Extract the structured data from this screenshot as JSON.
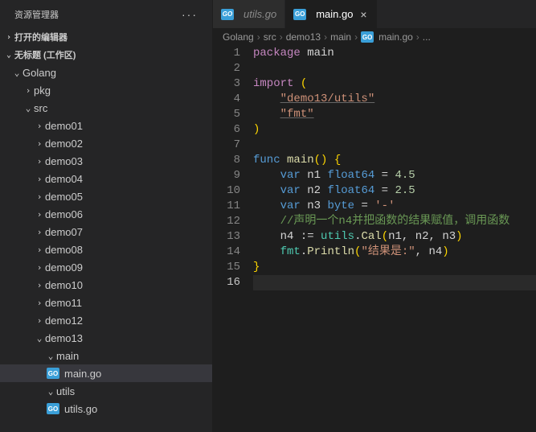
{
  "sidebar": {
    "title": "资源管理器",
    "sections": {
      "openEditors": "打开的编辑器",
      "workspace": "无标题 (工作区)"
    },
    "tree": {
      "golang": "Golang",
      "pkg": "pkg",
      "src": "src",
      "demos": [
        "demo01",
        "demo02",
        "demo03",
        "demo04",
        "demo05",
        "demo06",
        "demo07",
        "demo08",
        "demo09",
        "demo10",
        "demo11",
        "demo12",
        "demo13"
      ],
      "main": "main",
      "mainGo": "main.go",
      "utils": "utils",
      "utilsGo": "utils.go"
    }
  },
  "tabs": {
    "utils": "utils.go",
    "main": "main.go"
  },
  "breadcrumb": {
    "p0": "Golang",
    "p1": "src",
    "p2": "demo13",
    "p3": "main",
    "p4": "main.go",
    "p5": "..."
  },
  "goIconLabel": "GO",
  "code": {
    "lines": [
      {
        "n": 1,
        "html": "<span class='tok-kw'>package</span> <span class='tok-ident'>main</span>"
      },
      {
        "n": 2,
        "html": ""
      },
      {
        "n": 3,
        "html": "<span class='tok-kw'>import</span> <span class='tok-punc'>(</span>"
      },
      {
        "n": 4,
        "html": "    <span class='tok-str imp'>\"demo13/utils\"</span>"
      },
      {
        "n": 5,
        "html": "    <span class='tok-str imp'>\"fmt\"</span>"
      },
      {
        "n": 6,
        "html": "<span class='tok-punc'>)</span>"
      },
      {
        "n": 7,
        "html": ""
      },
      {
        "n": 8,
        "html": "<span class='tok-kw2'>func</span> <span class='tok-fn'>main</span><span class='tok-punc'>()</span> <span class='tok-punc'>{</span>"
      },
      {
        "n": 9,
        "html": "    <span class='tok-kw2'>var</span> <span class='tok-ident'>n1</span> <span class='tok-type'>float64</span> <span class='tok-op'>=</span> <span class='tok-num'>4.5</span>"
      },
      {
        "n": 10,
        "html": "    <span class='tok-kw2'>var</span> <span class='tok-ident'>n2</span> <span class='tok-type'>float64</span> <span class='tok-op'>=</span> <span class='tok-num'>2.5</span>"
      },
      {
        "n": 11,
        "html": "    <span class='tok-kw2'>var</span> <span class='tok-ident'>n3</span> <span class='tok-type'>byte</span> <span class='tok-op'>=</span> <span class='tok-str'>'-'</span>"
      },
      {
        "n": 12,
        "html": "    <span class='tok-cmt'>//声明一个n4并把函数的结果赋值，调用函数</span>"
      },
      {
        "n": 13,
        "html": "    <span class='tok-ident'>n4</span> <span class='tok-op'>:=</span> <span class='tok-pkg'>utils</span><span class='tok-op'>.</span><span class='tok-fn'>Cal</span><span class='tok-punc'>(</span><span class='tok-ident'>n1</span><span class='tok-op'>,</span> <span class='tok-ident'>n2</span><span class='tok-op'>,</span> <span class='tok-ident'>n3</span><span class='tok-punc'>)</span>"
      },
      {
        "n": 14,
        "html": "    <span class='tok-pkg'>fmt</span><span class='tok-op'>.</span><span class='tok-fn'>Println</span><span class='tok-punc'>(</span><span class='tok-str'>\"结果是:\"</span><span class='tok-op'>,</span> <span class='tok-ident'>n4</span><span class='tok-punc'>)</span>"
      },
      {
        "n": 15,
        "html": "<span class='tok-punc'>}</span>"
      },
      {
        "n": 16,
        "html": "",
        "cur": true
      }
    ]
  }
}
